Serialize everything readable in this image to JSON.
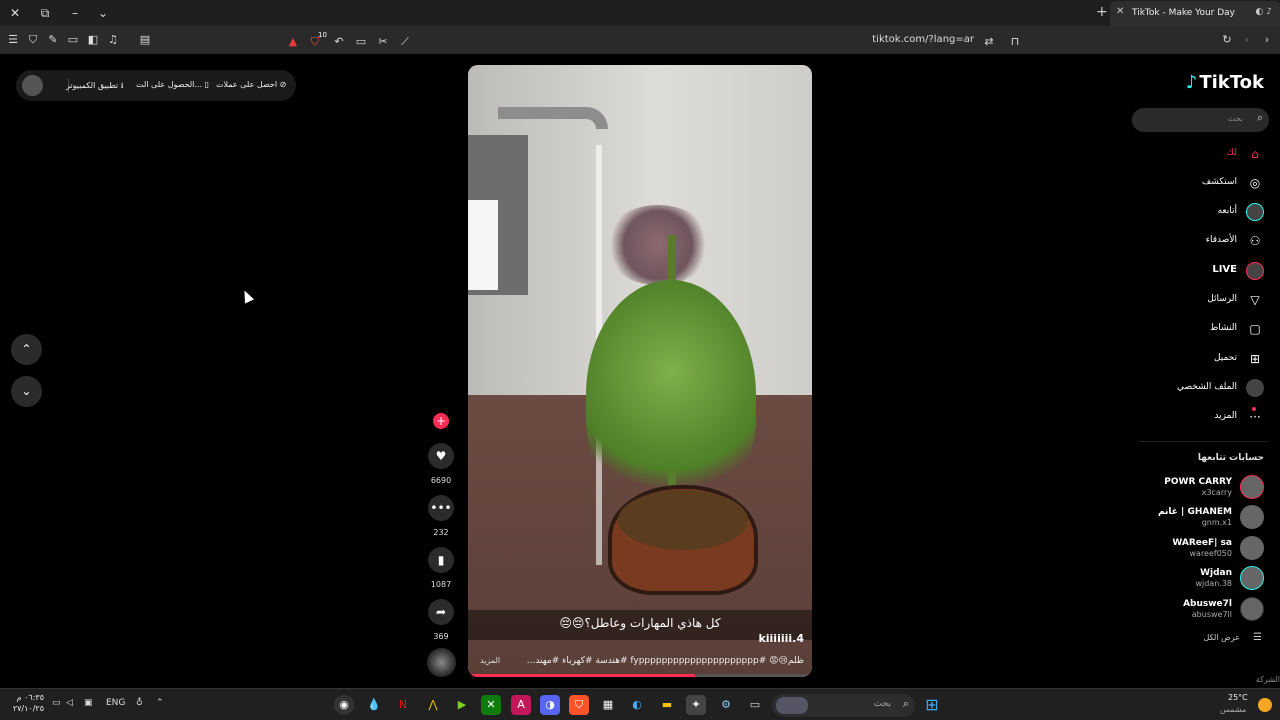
{
  "browser": {
    "tab_title": "TikTok - Make Your Day",
    "url": "tiktok.com/?lang=ar",
    "shields_badge": "10"
  },
  "overlay": {
    "get_coins": "احصل على عملات",
    "get_app": "الحصول على الت...",
    "desktop_app": "تطبيق الكمبيوتر"
  },
  "sidebar": {
    "logo": "TikTok",
    "search_placeholder": "بحث",
    "nav": [
      {
        "label": "لك",
        "icon": "home-icon"
      },
      {
        "label": "استكشف",
        "icon": "compass-icon"
      },
      {
        "label": "أتابعه",
        "icon": "avatar-icon"
      },
      {
        "label": "الأصدقاء",
        "icon": "friends-icon"
      },
      {
        "label": "LIVE",
        "icon": "live-icon"
      },
      {
        "label": "الرسائل",
        "icon": "send-icon"
      },
      {
        "label": "النشاط",
        "icon": "inbox-icon"
      },
      {
        "label": "تحميل",
        "icon": "upload-icon"
      },
      {
        "label": "الملف الشخصي",
        "icon": "profile-icon"
      },
      {
        "label": "المزيد",
        "icon": "more-icon"
      }
    ],
    "following_title": "حسابات تتابعها",
    "accounts": [
      {
        "name": "POWR CARRY",
        "handle": "x3carry"
      },
      {
        "name": "غانم | GHANEM",
        "handle": "gnm.x1"
      },
      {
        "name": "WAReeF| sa",
        "handle": "wareef050"
      },
      {
        "name": "Wjdan",
        "handle": "wjdan.38"
      },
      {
        "name": "Abuswe7l",
        "handle": "abuswe7ll"
      }
    ],
    "see_all": "عرض الكل",
    "company": "الشركة"
  },
  "video": {
    "caption": "كل هاذي المهارات وعاطل؟😔😔",
    "username": "kiiiiiii.4",
    "description": "ظلم😢😡 #fyppppppppppppppppppppp #هندسة #كهرباء #مهند...",
    "more": "المزيد",
    "progress": 0.66
  },
  "actions": {
    "likes": "6690",
    "comments": "232",
    "saves": "1087",
    "shares": "369"
  },
  "taskbar": {
    "time": "٠٦:٣٥ م",
    "date": "٢٧/١٠/٢٥",
    "lang": "ENG",
    "search_placeholder": "بحث",
    "temp": "25°C",
    "condition": "مشمس"
  }
}
